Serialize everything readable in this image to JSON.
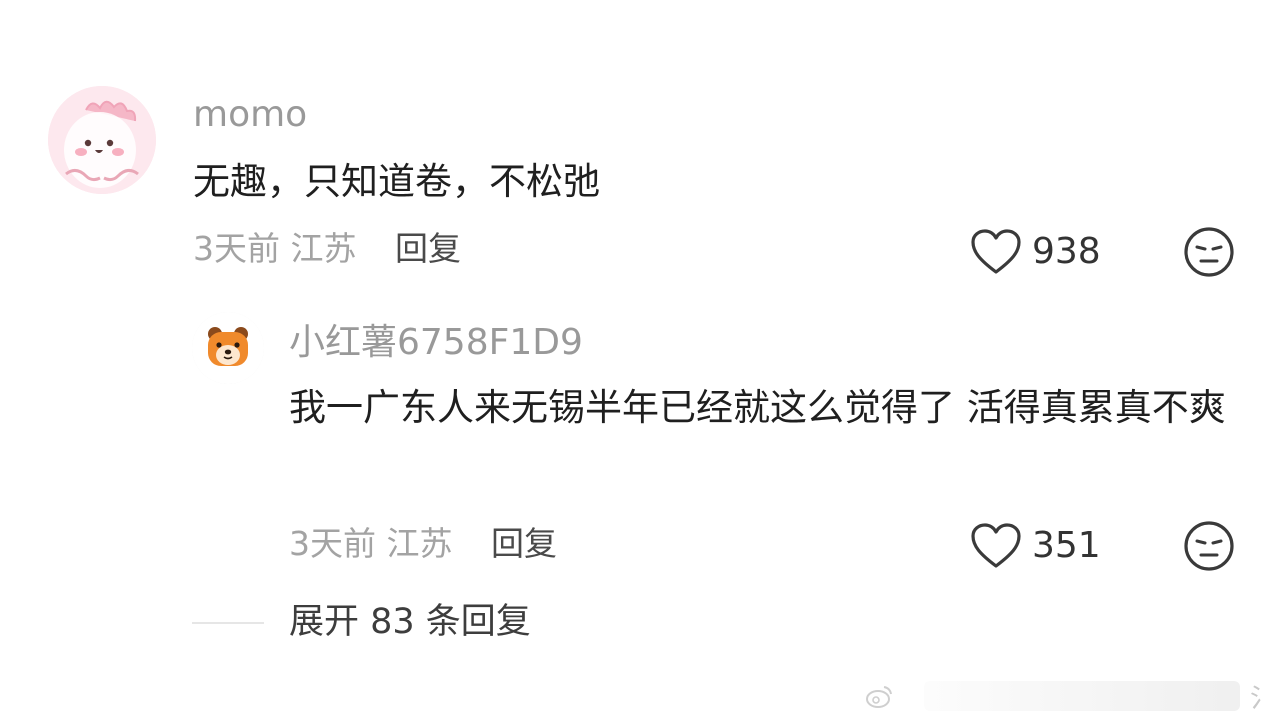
{
  "comment": {
    "username": "momo",
    "text": "无趣，只知道卷，不松弛",
    "time": "3天前",
    "location": "江苏",
    "reply_label": "回复",
    "likes": "938"
  },
  "reply": {
    "username": "小红薯6758F1D9",
    "text": "我一广东人来无锡半年已经就这么觉得了 活得真累真不爽",
    "time": "3天前",
    "location": "江苏",
    "reply_label": "回复",
    "likes": "351"
  },
  "expand_label": "展开 83 条回复",
  "watermark": {
    "char": "氵",
    "logo_icon": "weibo-logo-icon"
  },
  "colors": {
    "username": "#999999",
    "content": "#1f1f1f",
    "meta": "#a3a3a3",
    "reply_action": "#4a4a4a",
    "avatar1_bg": "#fce4ea",
    "avatar2_bg": "#f08a2c"
  }
}
